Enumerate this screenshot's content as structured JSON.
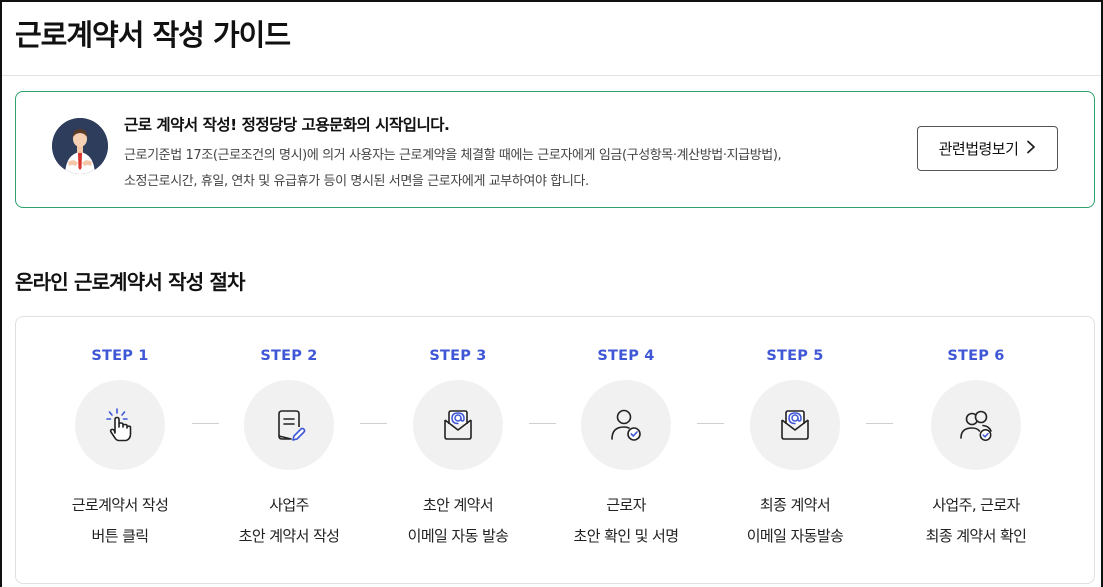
{
  "page": {
    "title": "근로계약서 작성 가이드"
  },
  "notice": {
    "title": "근로 계약서 작성! 정정당당 고용문화의 시작입니다.",
    "line1": "근로기준법 17조(근로조건의 명시)에 의거 사용자는 근로계약을 체결할 때에는 근로자에게 임금(구성항목·계산방법·지급방법),",
    "line2": "소정근로시간, 휴일, 연차 및 유급휴가 등이 명시된 서면을 근로자에게 교부하여야 합니다.",
    "button_label": "관련법령보기",
    "button_icon": "chevron-right-icon"
  },
  "procedure": {
    "title": "온라인 근로계약서 작성 절차",
    "steps": [
      {
        "label": "STEP 1",
        "icon": "hand-click-icon",
        "desc1": "근로계약서 작성",
        "desc2": "버튼 클릭"
      },
      {
        "label": "STEP 2",
        "icon": "document-edit-icon",
        "desc1": "사업주",
        "desc2": "초안 계약서 작성"
      },
      {
        "label": "STEP 3",
        "icon": "email-envelope-icon",
        "desc1": "초안 계약서",
        "desc2": "이메일 자동 발송"
      },
      {
        "label": "STEP 4",
        "icon": "user-check-icon",
        "desc1": "근로자",
        "desc2": "초안 확인 및 서명"
      },
      {
        "label": "STEP 5",
        "icon": "email-envelope-icon",
        "desc1": "최종 계약서",
        "desc2": "이메일 자동발송"
      },
      {
        "label": "STEP 6",
        "icon": "users-check-icon",
        "desc1": "사업주, 근로자",
        "desc2": "최종 계약서 확인"
      }
    ]
  },
  "colors": {
    "accent_blue": "#3f57d6",
    "notice_border": "#2da36b",
    "avatar_bg": "#2f3d5c",
    "icon_check": "#3f57d6"
  }
}
